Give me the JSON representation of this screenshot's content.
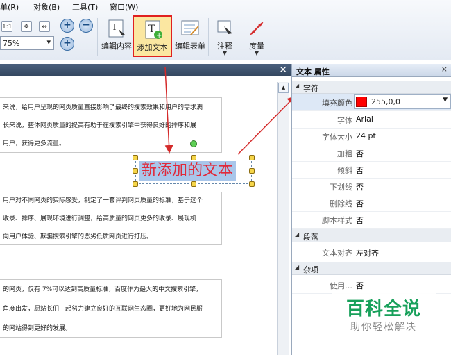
{
  "menu": {
    "items": [
      "单(R)",
      "对象(B)",
      "工具(T)",
      "窗口(W)"
    ]
  },
  "toolbar": {
    "zoom_value": "75%",
    "fit_label": "1:1",
    "buttons": [
      {
        "label": "编辑内容",
        "icon": "edit-content-icon"
      },
      {
        "label": "添加文本",
        "icon": "add-text-icon"
      },
      {
        "label": "编辑表单",
        "icon": "edit-form-icon"
      },
      {
        "label": "注释",
        "icon": "comment-icon"
      },
      {
        "label": "度量",
        "icon": "measure-icon"
      }
    ]
  },
  "document": {
    "close_glyph": "✕",
    "block1": [
      "来说，给用户呈现的网页质量直接影响了最终的搜索效果和用户的需求满",
      "长来说，整体网页质量的提高有助于在搜索引擎中获得良好的排序和展",
      "用户，获得更多流量。"
    ],
    "new_text": "新添加的文本",
    "block2": [
      "用户对不同网页的实际感受，制定了一套评判网页质量的标准，基于这个",
      "收录、排序、展现环境进行调整，给高质量的网页更多的收录、展现机",
      "向用户体验、欺骗搜索引擎的恶劣低质网页进行打压。"
    ],
    "block3": [
      "的网页，仅有 7%可以达到高质量标准，百度作为最大的中文搜索引擎，",
      "角度出发，愿站长们一起努力建立良好的互联网生态圈，更好地为网民服",
      "的网站得到更好的发展。"
    ]
  },
  "properties": {
    "title": "文本 属性",
    "close_glyph": "×",
    "categories": {
      "character": "字符",
      "paragraph": "段落",
      "misc": "杂项"
    },
    "rows": {
      "fill_color": {
        "key": "填充颜色",
        "value": "255,0,0",
        "swatch": "#ff0000"
      },
      "font": {
        "key": "字体",
        "value": "Arial"
      },
      "font_size": {
        "key": "字体大小",
        "value": "24 pt"
      },
      "bold": {
        "key": "加粗",
        "value": "否"
      },
      "italic": {
        "key": "倾斜",
        "value": "否"
      },
      "underline": {
        "key": "下划线",
        "value": "否"
      },
      "strikethrough": {
        "key": "删除线",
        "value": "否"
      },
      "script_style": {
        "key": "脚本样式",
        "value": "否"
      },
      "text_align": {
        "key": "文本对齐",
        "value": "左对齐"
      },
      "misc_row": {
        "key": "使用…",
        "value": "否"
      }
    }
  },
  "watermark": {
    "title": "百科全说",
    "subtitle": "助你轻松解决"
  },
  "colors": {
    "highlight_border": "#e02020",
    "annotation_arrow": "#d42a2a",
    "text_color": "#e0293a"
  }
}
